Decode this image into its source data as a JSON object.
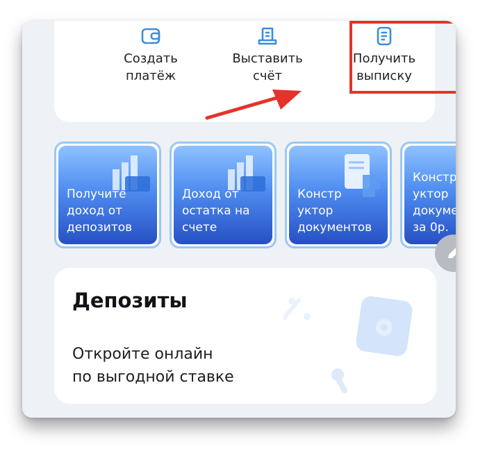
{
  "actions": {
    "create_payment": "Создать\nплатёж",
    "issue_invoice": "Выставить\nсчёт",
    "get_statement": "Получить\nвыписку"
  },
  "promos": [
    {
      "text": "Получите\nдоход от\nдепозитов"
    },
    {
      "text": "Доход от\nостатка на\nсчете"
    },
    {
      "text": "Констр\nуктор\nдокументов"
    },
    {
      "text": "Констр\nуктор\nдокуме\nза 0р."
    }
  ],
  "deposits": {
    "title": "Депозиты",
    "description": "Откройте онлайн\nпо выгодной ставке"
  },
  "colors": {
    "accent": "#3a8dde",
    "highlight": "#e5332a",
    "card_gradient_top": "#8fc2ff",
    "card_gradient_bottom": "#2650c4"
  },
  "icons": {
    "create_payment": "wallet-icon",
    "issue_invoice": "invoice-icon",
    "get_statement": "document-icon",
    "edit": "pencil-icon"
  }
}
